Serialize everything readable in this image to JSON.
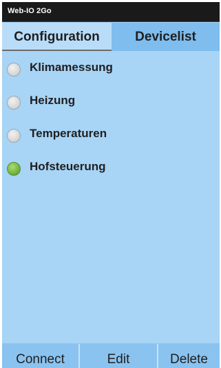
{
  "app": {
    "title": "Web-IO 2Go"
  },
  "tabs": [
    {
      "label": "Configuration",
      "selected": true
    },
    {
      "label": "Devicelist",
      "selected": false
    }
  ],
  "devices": [
    {
      "label": "Klimamessung",
      "state": "off"
    },
    {
      "label": "Heizung",
      "state": "off"
    },
    {
      "label": "Temperaturen",
      "state": "off"
    },
    {
      "label": "Hofsteuerung",
      "state": "on"
    }
  ],
  "bottom_bar": {
    "connect_label": "Connect",
    "edit_label": "Edit",
    "delete_label": "Delete"
  },
  "colors": {
    "background": "#a8d4f6",
    "tab_selected": "#b9ddf9",
    "tab_unselected": "#7fbdee",
    "status_on": "#72b43f",
    "status_off": "#d8d8d8"
  },
  "icons": {
    "status_indicator": "radio-indicator-icon"
  }
}
